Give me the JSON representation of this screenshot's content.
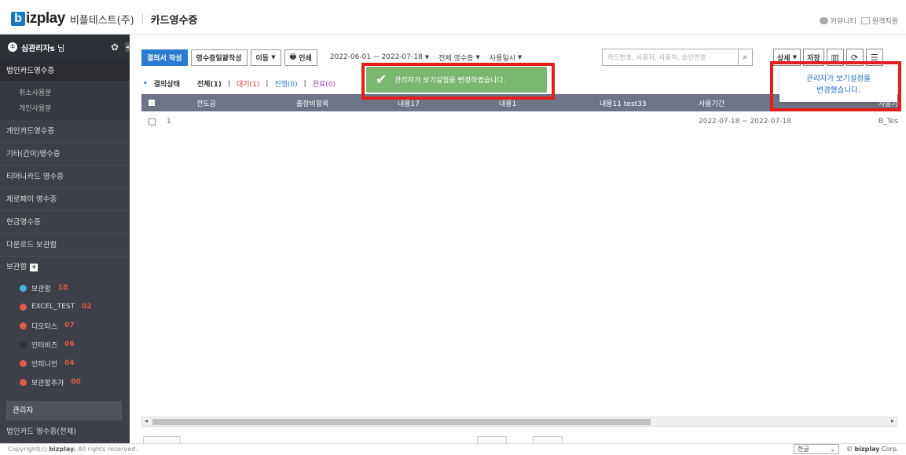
{
  "header": {
    "logo_b": "b",
    "logo_rest": "izplay",
    "company": "비플테스트(주)",
    "page_title": "카드영수증",
    "links": [
      "커뮤니티",
      "원격지원"
    ]
  },
  "sidebar": {
    "profile_name": "심관리자s",
    "profile_suffix": "님",
    "items": [
      {
        "label": "법인카드영수증"
      },
      {
        "label": "취소사용분"
      },
      {
        "label": "개인사용분"
      },
      {
        "label": "개인카드영수증"
      },
      {
        "label": "기타(간이)영수증"
      },
      {
        "label": "티머니카드 영수증"
      },
      {
        "label": "제로페이 영수증"
      },
      {
        "label": "현금영수증"
      },
      {
        "label": "다운로드 보관함"
      }
    ],
    "folders_header": "보관함",
    "folders": [
      {
        "label": "보관함",
        "count": "18",
        "color": "#46b3d9"
      },
      {
        "label": "EXCEL_TEST",
        "count": "02",
        "color": "#e05a4a"
      },
      {
        "label": "디오티스",
        "count": "07",
        "color": "#e05a4a"
      },
      {
        "label": "인터비즈",
        "count": "06",
        "color": "#333333"
      },
      {
        "label": "인피니언",
        "count": "04",
        "color": "#e05a4a"
      },
      {
        "label": "보관함추가",
        "count": "00",
        "color": "#e05a4a"
      }
    ],
    "admin_header": "관리자",
    "admin_item": "법인카드 영수증(전체)"
  },
  "toolbar": {
    "create_label": "결의서 작성",
    "batch_label": "영수증일괄작성",
    "move_label": "이동",
    "print_label": "인쇄",
    "date_range": "2022-06-01 ~ 2022-07-18",
    "filter_all": "전체 영수증",
    "filter_date": "사용일시",
    "search_placeholder": "카드번호, 사용자, 사용처, 승인번호",
    "detail_label": "상세",
    "save_label": "저장"
  },
  "status": {
    "label": "결의상태",
    "all": "전체(1)",
    "wait": "대기(1)",
    "progress": "진행(0)",
    "done": "완료(0)"
  },
  "table": {
    "columns": [
      "전도금",
      "출장비항목",
      "내용17",
      "내용1",
      "내용11 test33",
      "사용기간",
      "사용기"
    ],
    "rows": [
      {
        "no": "1",
        "period": "2022-07-18 ~ 2022-07-18",
        "user": "B_Tes"
      }
    ]
  },
  "toast": {
    "message": "관리자가 보기설정을 변경하였습니다."
  },
  "notice": {
    "line1": "관리자가 보기설정을",
    "line2": "변경했습니다."
  },
  "footer": {
    "copyright_prefix": "Copyright(c)",
    "copyright_brand": "bizplay.",
    "copyright_suffix": "All rights reserved.",
    "language": "한글",
    "brand_prefix": "©",
    "brand_name": "bizplay",
    "brand_suffix": "Corp."
  }
}
